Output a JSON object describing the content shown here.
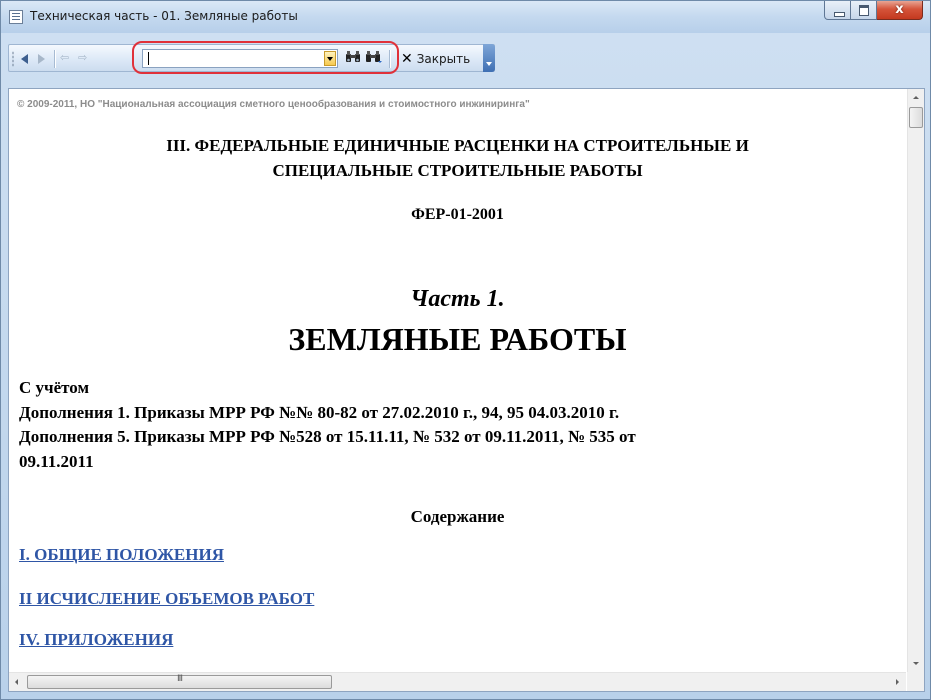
{
  "window": {
    "title": "Техническая часть - 01. Земляные работы",
    "close_glyph": "x"
  },
  "toolbar": {
    "search_value": "",
    "find_icon": "binoculars-icon",
    "find_next_icon": "binoculars-next-icon",
    "close_label": "Закрыть",
    "close_glyph": "✕"
  },
  "document": {
    "copyright": "© 2009-2011, НО \"Национальная ассоциация сметного ценообразования и стоимостного инжиниринга\"",
    "section_title_line1": "III. ФЕДЕРАЛЬНЫЕ ЕДИНИЧНЫЕ РАСЦЕНКИ НА СТРОИТЕЛЬНЫЕ И",
    "section_title_line2": "СПЕЦИАЛЬНЫЕ СТРОИТЕЛЬНЫЕ РАБОТЫ",
    "code": "ФЕР-01-2001",
    "part": "Часть 1.",
    "heading": "ЗЕМЛЯНЫЕ РАБОТЫ",
    "accounting": [
      "С учётом",
      "Дополнения 1. Приказы МРР РФ №№ 80-82 от 27.02.2010 г., 94, 95 04.03.2010 г.",
      "Дополнения 5. Приказы МРР РФ №528 от 15.11.11, № 532 от 09.11.2011, № 535 от",
      "09.11.2011"
    ],
    "toc_title": "Содержание",
    "toc_links": [
      "I. ОБЩИЕ ПОЛОЖЕНИЯ",
      "II ИСЧИСЛЕНИЕ ОБЪЕМОВ РАБОТ",
      "IV. ПРИЛОЖЕНИЯ"
    ]
  },
  "scrollbar": {
    "thumb_grip": "III"
  },
  "colors": {
    "link": "#2f56a6",
    "highlight": "#e0313a",
    "copyright": "#8c8c8c"
  }
}
